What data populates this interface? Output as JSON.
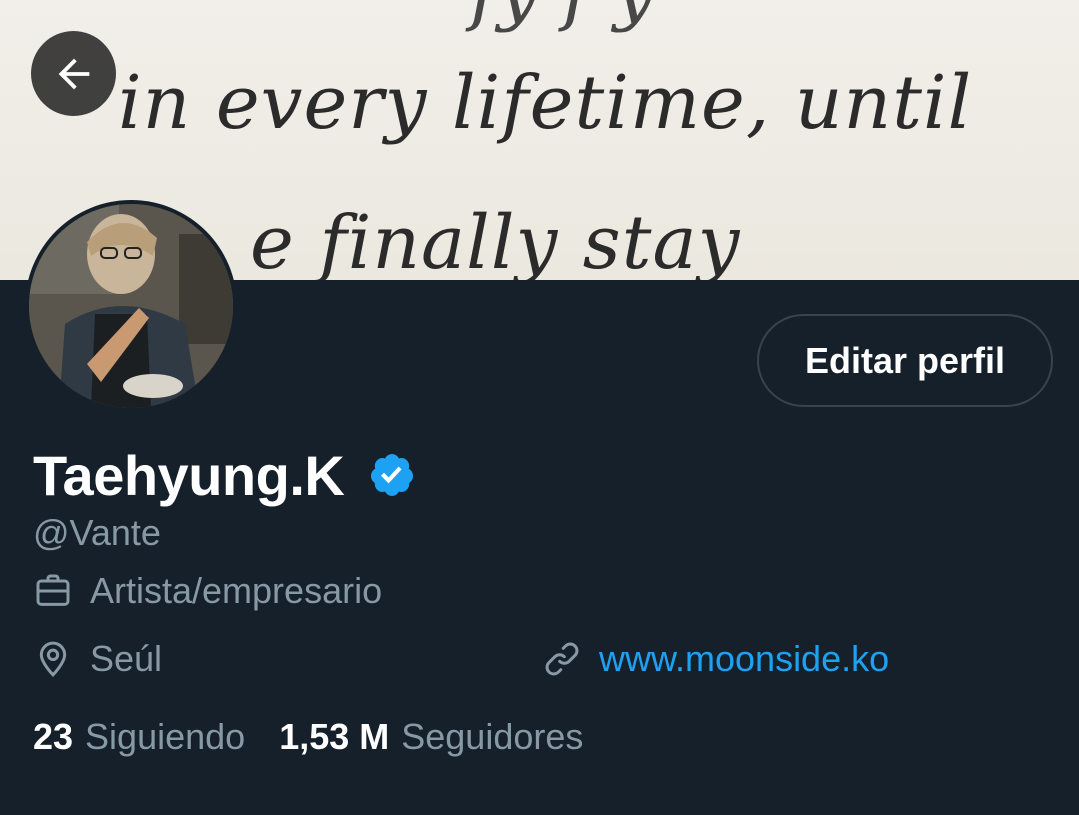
{
  "banner": {
    "lines": [
      "fy f y",
      "in every lifetime, until",
      "e finally stay"
    ]
  },
  "header": {
    "back_icon": "arrow-left-icon"
  },
  "profile": {
    "avatar_icon": "profile-photo",
    "edit_button_label": "Editar perfil",
    "display_name": "Taehyung.K",
    "verified_icon": "verified-badge-icon",
    "handle": "@Vante",
    "bio": {
      "icon": "briefcase-icon",
      "text": "Artista/empresario"
    },
    "location": {
      "icon": "location-pin-icon",
      "text": "Seúl"
    },
    "website": {
      "icon": "link-icon",
      "text": "www.moonside.ko"
    },
    "stats": [
      {
        "value": "23",
        "label": "Siguiendo"
      },
      {
        "value": "1,53 M",
        "label": "Seguidores"
      }
    ]
  },
  "colors": {
    "background": "#15202b",
    "primary_text": "#ffffff",
    "secondary_text": "#8899a6",
    "accent": "#1da1f2",
    "border": "#38444d"
  }
}
